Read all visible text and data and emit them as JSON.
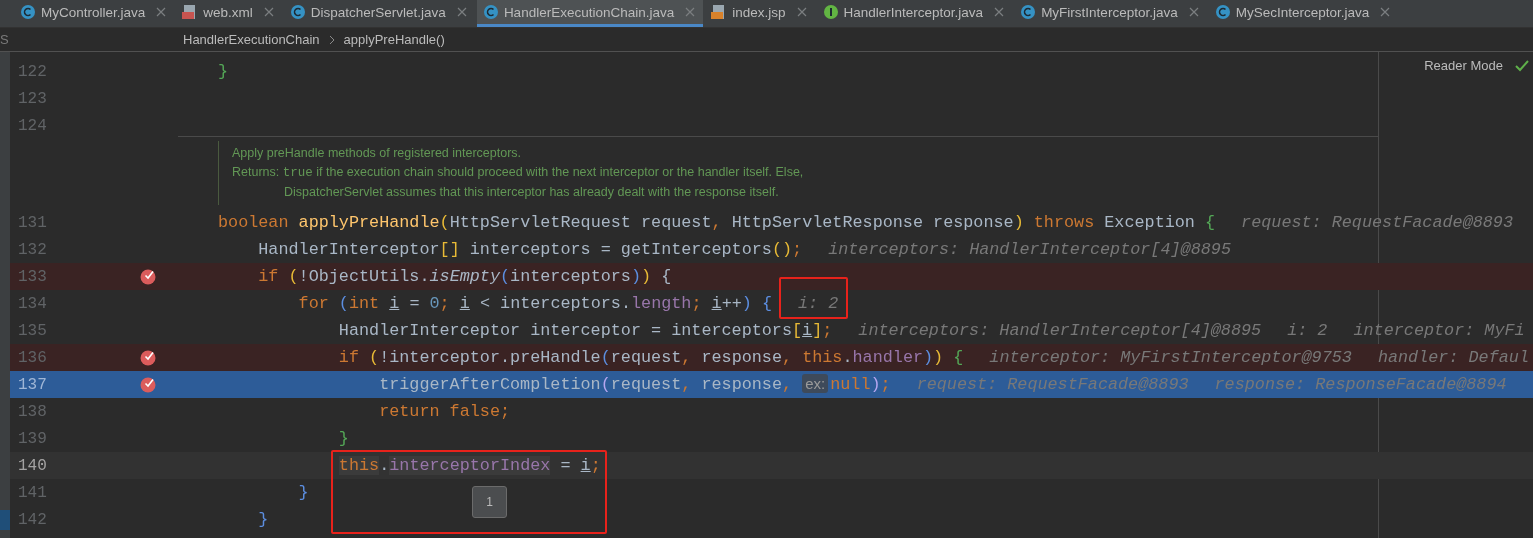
{
  "tabs": [
    {
      "label": "MyController.java",
      "kind": "class",
      "selected": false
    },
    {
      "label": "web.xml",
      "kind": "xml",
      "selected": false
    },
    {
      "label": "DispatcherServlet.java",
      "kind": "class",
      "selected": false
    },
    {
      "label": "HandlerExecutionChain.java",
      "kind": "class",
      "selected": true
    },
    {
      "label": "index.jsp",
      "kind": "jsp",
      "selected": false
    },
    {
      "label": "HandlerInterceptor.java",
      "kind": "interface",
      "selected": false
    },
    {
      "label": "MyFirstInterceptor.java",
      "kind": "class",
      "selected": false
    },
    {
      "label": "MySecInterceptor.java",
      "kind": "class",
      "selected": false
    }
  ],
  "side_panel_label": "S",
  "breadcrumb": [
    "HandlerExecutionChain",
    "applyPreHandle()"
  ],
  "reader_mode": "Reader Mode",
  "lines_before": [
    {
      "number": "122",
      "tokens": [
        {
          "kind": "br3",
          "t": "}"
        }
      ]
    },
    {
      "number": "123"
    },
    {
      "number": "124"
    }
  ],
  "doc": {
    "summary": "Apply preHandle methods of registered interceptors.",
    "returns_label": "Returns:",
    "returns_code": "true",
    "returns_line1": "if the execution chain should proceed with the next interceptor or the handler itself. Else,",
    "returns_line2": "DispatcherServlet assumes that this interceptor has already dealt with the response itself."
  },
  "lines": [
    {
      "number": "131",
      "breakpoint": false,
      "current": false,
      "caret": false,
      "tokens": [
        {
          "kind": "kw",
          "t": "boolean "
        },
        {
          "kind": "fn",
          "t": "applyPreHandle"
        },
        {
          "kind": "br1",
          "t": "("
        },
        {
          "kind": "txt",
          "t": "HttpServletRequest request"
        },
        {
          "kind": "kw",
          "t": ", "
        },
        {
          "kind": "txt",
          "t": "HttpServletResponse response"
        },
        {
          "kind": "br1",
          "t": ")"
        },
        {
          "kind": "kw",
          "t": " throws "
        },
        {
          "kind": "txt",
          "t": "Exception "
        },
        {
          "kind": "br3",
          "t": "{"
        },
        {
          "kind": "hint",
          "t": "request: RequestFacade@8893"
        }
      ]
    },
    {
      "number": "132",
      "breakpoint": false,
      "current": false,
      "caret": false,
      "tokens": [
        {
          "kind": "txt",
          "t": "    HandlerInterceptor"
        },
        {
          "kind": "br1",
          "t": "[]"
        },
        {
          "kind": "txt",
          "t": " interceptors = getInterceptors"
        },
        {
          "kind": "br1",
          "t": "()"
        },
        {
          "kind": "kw",
          "t": ";"
        },
        {
          "kind": "hint",
          "t": "interceptors: HandlerInterceptor[4]@8895"
        }
      ]
    },
    {
      "number": "133",
      "breakpoint": true,
      "current": false,
      "caret": false,
      "tokens": [
        {
          "kind": "kw",
          "t": "    if "
        },
        {
          "kind": "br1",
          "t": "("
        },
        {
          "kind": "txt",
          "t": "!ObjectUtils."
        },
        {
          "kind": "it",
          "t": "isEmpty"
        },
        {
          "kind": "br2",
          "t": "("
        },
        {
          "kind": "txt",
          "t": "interceptors"
        },
        {
          "kind": "br2",
          "t": ")"
        },
        {
          "kind": "br1",
          "t": ")"
        },
        {
          "kind": "txt",
          "t": " {"
        }
      ]
    },
    {
      "number": "134",
      "breakpoint": false,
      "current": false,
      "caret": false,
      "tokens": [
        {
          "kind": "kw",
          "t": "        for "
        },
        {
          "kind": "br2",
          "t": "("
        },
        {
          "kind": "kw",
          "t": "int "
        },
        {
          "kind": "var",
          "t": "i"
        },
        {
          "kind": "txt",
          "t": " = "
        },
        {
          "kind": "num",
          "t": "0"
        },
        {
          "kind": "kw",
          "t": "; "
        },
        {
          "kind": "var",
          "t": "i"
        },
        {
          "kind": "txt",
          "t": " < interceptors."
        },
        {
          "kind": "fld",
          "t": "length"
        },
        {
          "kind": "kw",
          "t": "; "
        },
        {
          "kind": "var",
          "t": "i"
        },
        {
          "kind": "txt",
          "t": "++"
        },
        {
          "kind": "br2",
          "t": ")"
        },
        {
          "kind": "br2",
          "t": " {"
        },
        {
          "kind": "hint",
          "t": "i: 2"
        }
      ]
    },
    {
      "number": "135",
      "breakpoint": false,
      "current": false,
      "caret": false,
      "tokens": [
        {
          "kind": "txt",
          "t": "            HandlerInterceptor interceptor = interceptors"
        },
        {
          "kind": "br1",
          "t": "["
        },
        {
          "kind": "var",
          "t": "i"
        },
        {
          "kind": "br1",
          "t": "]"
        },
        {
          "kind": "kw",
          "t": ";"
        },
        {
          "kind": "hint",
          "t": "interceptors: HandlerInterceptor[4]@8895"
        },
        {
          "kind": "hint",
          "t": "i: 2"
        },
        {
          "kind": "hint",
          "t": "interceptor: MyFi"
        }
      ]
    },
    {
      "number": "136",
      "breakpoint": true,
      "current": false,
      "caret": false,
      "tokens": [
        {
          "kind": "kw",
          "t": "            if "
        },
        {
          "kind": "br1",
          "t": "("
        },
        {
          "kind": "txt",
          "t": "!interceptor.preHandle"
        },
        {
          "kind": "br2",
          "t": "("
        },
        {
          "kind": "txt",
          "t": "request"
        },
        {
          "kind": "kw",
          "t": ", "
        },
        {
          "kind": "txt",
          "t": "response"
        },
        {
          "kind": "kw",
          "t": ", this"
        },
        {
          "kind": "txt",
          "t": "."
        },
        {
          "kind": "fld",
          "t": "handler"
        },
        {
          "kind": "br2",
          "t": ")"
        },
        {
          "kind": "br1",
          "t": ")"
        },
        {
          "kind": "br3",
          "t": " {"
        },
        {
          "kind": "hint",
          "t": "interceptor: MyFirstInterceptor@9753"
        },
        {
          "kind": "hint",
          "t": "handler: Defaul"
        }
      ]
    },
    {
      "number": "137",
      "breakpoint": true,
      "current": true,
      "caret": false,
      "tokens": [
        {
          "kind": "txt",
          "t": "                triggerAfterCompletion"
        },
        {
          "kind": "br4",
          "t": "("
        },
        {
          "kind": "txt",
          "t": "request"
        },
        {
          "kind": "kw",
          "t": ", "
        },
        {
          "kind": "txt",
          "t": "response"
        },
        {
          "kind": "kw",
          "t": ", "
        },
        {
          "kind": "chip",
          "t": "ex:"
        },
        {
          "kind": "kw",
          "t": "null"
        },
        {
          "kind": "br4",
          "t": ")"
        },
        {
          "kind": "kw",
          "t": ";"
        },
        {
          "kind": "hint",
          "t": "request: RequestFacade@8893"
        },
        {
          "kind": "hint",
          "t": "response: ResponseFacade@8894"
        }
      ]
    },
    {
      "number": "138",
      "breakpoint": false,
      "current": false,
      "caret": false,
      "tokens": [
        {
          "kind": "kw",
          "t": "                return false;"
        }
      ]
    },
    {
      "number": "139",
      "breakpoint": false,
      "current": false,
      "caret": false,
      "tokens": [
        {
          "kind": "br3",
          "t": "            }"
        }
      ]
    },
    {
      "number": "140",
      "breakpoint": false,
      "current": false,
      "caret": true,
      "tokens": [
        {
          "kind": "selkw",
          "t": "            this"
        },
        {
          "kind": "txt",
          "t": "."
        },
        {
          "kind": "selfld",
          "t": "interceptorIndex"
        },
        {
          "kind": "txt",
          "t": " = "
        },
        {
          "kind": "var",
          "t": "i"
        },
        {
          "kind": "kw",
          "t": ";"
        }
      ]
    },
    {
      "number": "141",
      "breakpoint": false,
      "current": false,
      "caret": false,
      "tokens": [
        {
          "kind": "br2",
          "t": "        }"
        }
      ]
    },
    {
      "number": "142",
      "breakpoint": false,
      "current": false,
      "caret": false,
      "tokens": [
        {
          "kind": "br2",
          "t": "    }"
        }
      ]
    }
  ],
  "tooltip": "1"
}
